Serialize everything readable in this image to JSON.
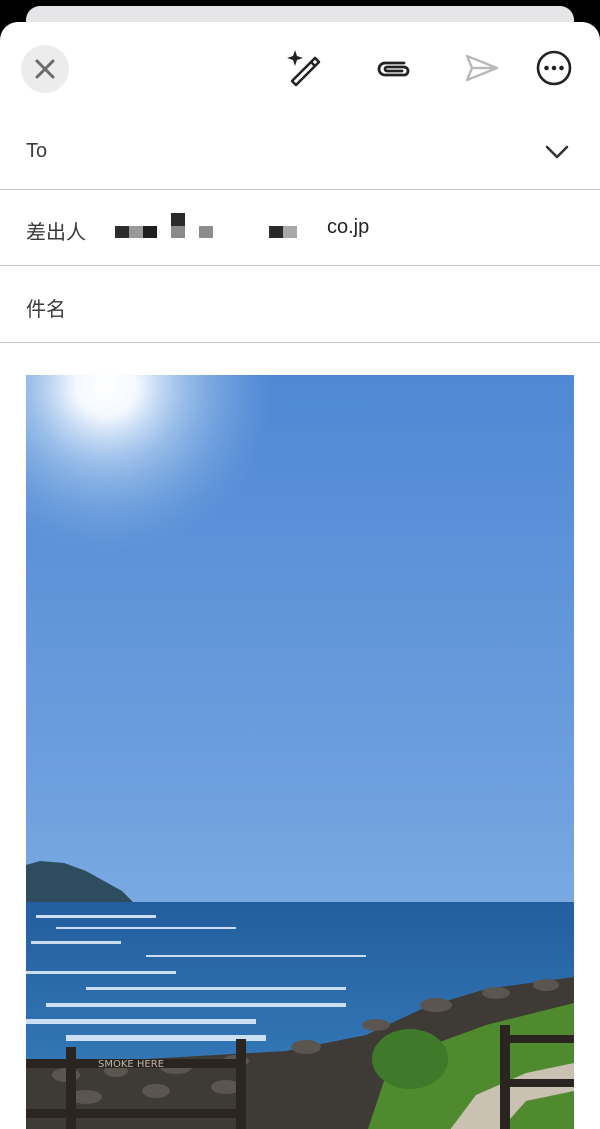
{
  "compose": {
    "to_label": "To",
    "from_label": "差出人",
    "sender_domain": "co.jp",
    "subject_label": "件名",
    "subject_value": ""
  },
  "toolbar": {
    "icons": [
      "close-icon",
      "magic-pen-icon",
      "paperclip-icon",
      "send-icon",
      "more-icon"
    ]
  },
  "attachment": {
    "image_subject": "seaside photo with sun, sea, rocks and a wooden fence",
    "sign_text": "SMOKE HERE"
  },
  "colors": {
    "sheet": "#ffffff",
    "divider": "#c8c8c8",
    "send_disabled": "#b9b9b9",
    "sky_top": "#4f88d4",
    "sea": "#2c6fb0"
  }
}
